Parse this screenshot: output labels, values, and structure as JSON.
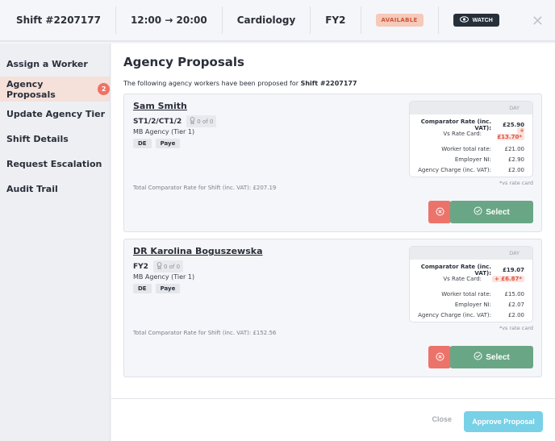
{
  "topbar": {
    "shift_id": "Shift #2207177",
    "time": "12:00 → 20:00",
    "department": "Cardiology",
    "grade": "FY2",
    "status": "AVAILABLE",
    "watch_label": "WATCH",
    "close_icon": "close-icon"
  },
  "sidebar": {
    "items": [
      {
        "label": "Assign a Worker"
      },
      {
        "label": "Agency Proposals",
        "badge": "2",
        "active": true
      },
      {
        "label": "Update Agency Tier"
      },
      {
        "label": "Shift Details"
      },
      {
        "label": "Request Escalation"
      },
      {
        "label": "Audit Trail"
      }
    ]
  },
  "main": {
    "title": "Agency Proposals",
    "intro_text": "The following agency workers have been proposed for ",
    "intro_shift": "Shift #2207177",
    "rate_header": "DAY",
    "labels": {
      "comparator": "Comparator Rate (inc. VAT):",
      "vs_rate_card": "Vs Rate Card:",
      "worker_total": "Worker total rate:",
      "employer_ni": "Employer NI:",
      "agency_charge": "Agency Charge (inc. VAT):",
      "vs_note": "*vs rate card",
      "select": "Select"
    },
    "proposals": [
      {
        "name": "Sam Smith",
        "grade": "ST1/2/CT1/2",
        "award": "0 of 0",
        "agency": "MB Agency (Tier 1)",
        "tags": [
          "DE",
          "Paye"
        ],
        "total": "Total Comparator Rate for Shift (inc. VAT): £207.19",
        "comparator_rate": "£25.90",
        "vs_rate_card": "+ £13.70*",
        "worker_total": "£21.00",
        "employer_ni": "£2.90",
        "agency_charge": "£2.00"
      },
      {
        "name": "DR Karolina Boguszewska",
        "grade": "FY2",
        "award": "0 of 0",
        "agency": "MB Agency (Tier 1)",
        "tags": [
          "DE",
          "Paye"
        ],
        "total": "Total Comparator Rate for Shift (inc. VAT): £152.56",
        "comparator_rate": "£19.07",
        "vs_rate_card": "+ £6.87*",
        "worker_total": "£15.00",
        "employer_ni": "£2.07",
        "agency_charge": "£2.00"
      }
    ]
  },
  "footer": {
    "close_label": "Close",
    "approve_label": "Approve Proposal"
  },
  "colors": {
    "accent_red": "#ec736a",
    "accent_green": "#69a685",
    "accent_blue": "#78d1e6",
    "available_bg": "#f6c9b9"
  }
}
